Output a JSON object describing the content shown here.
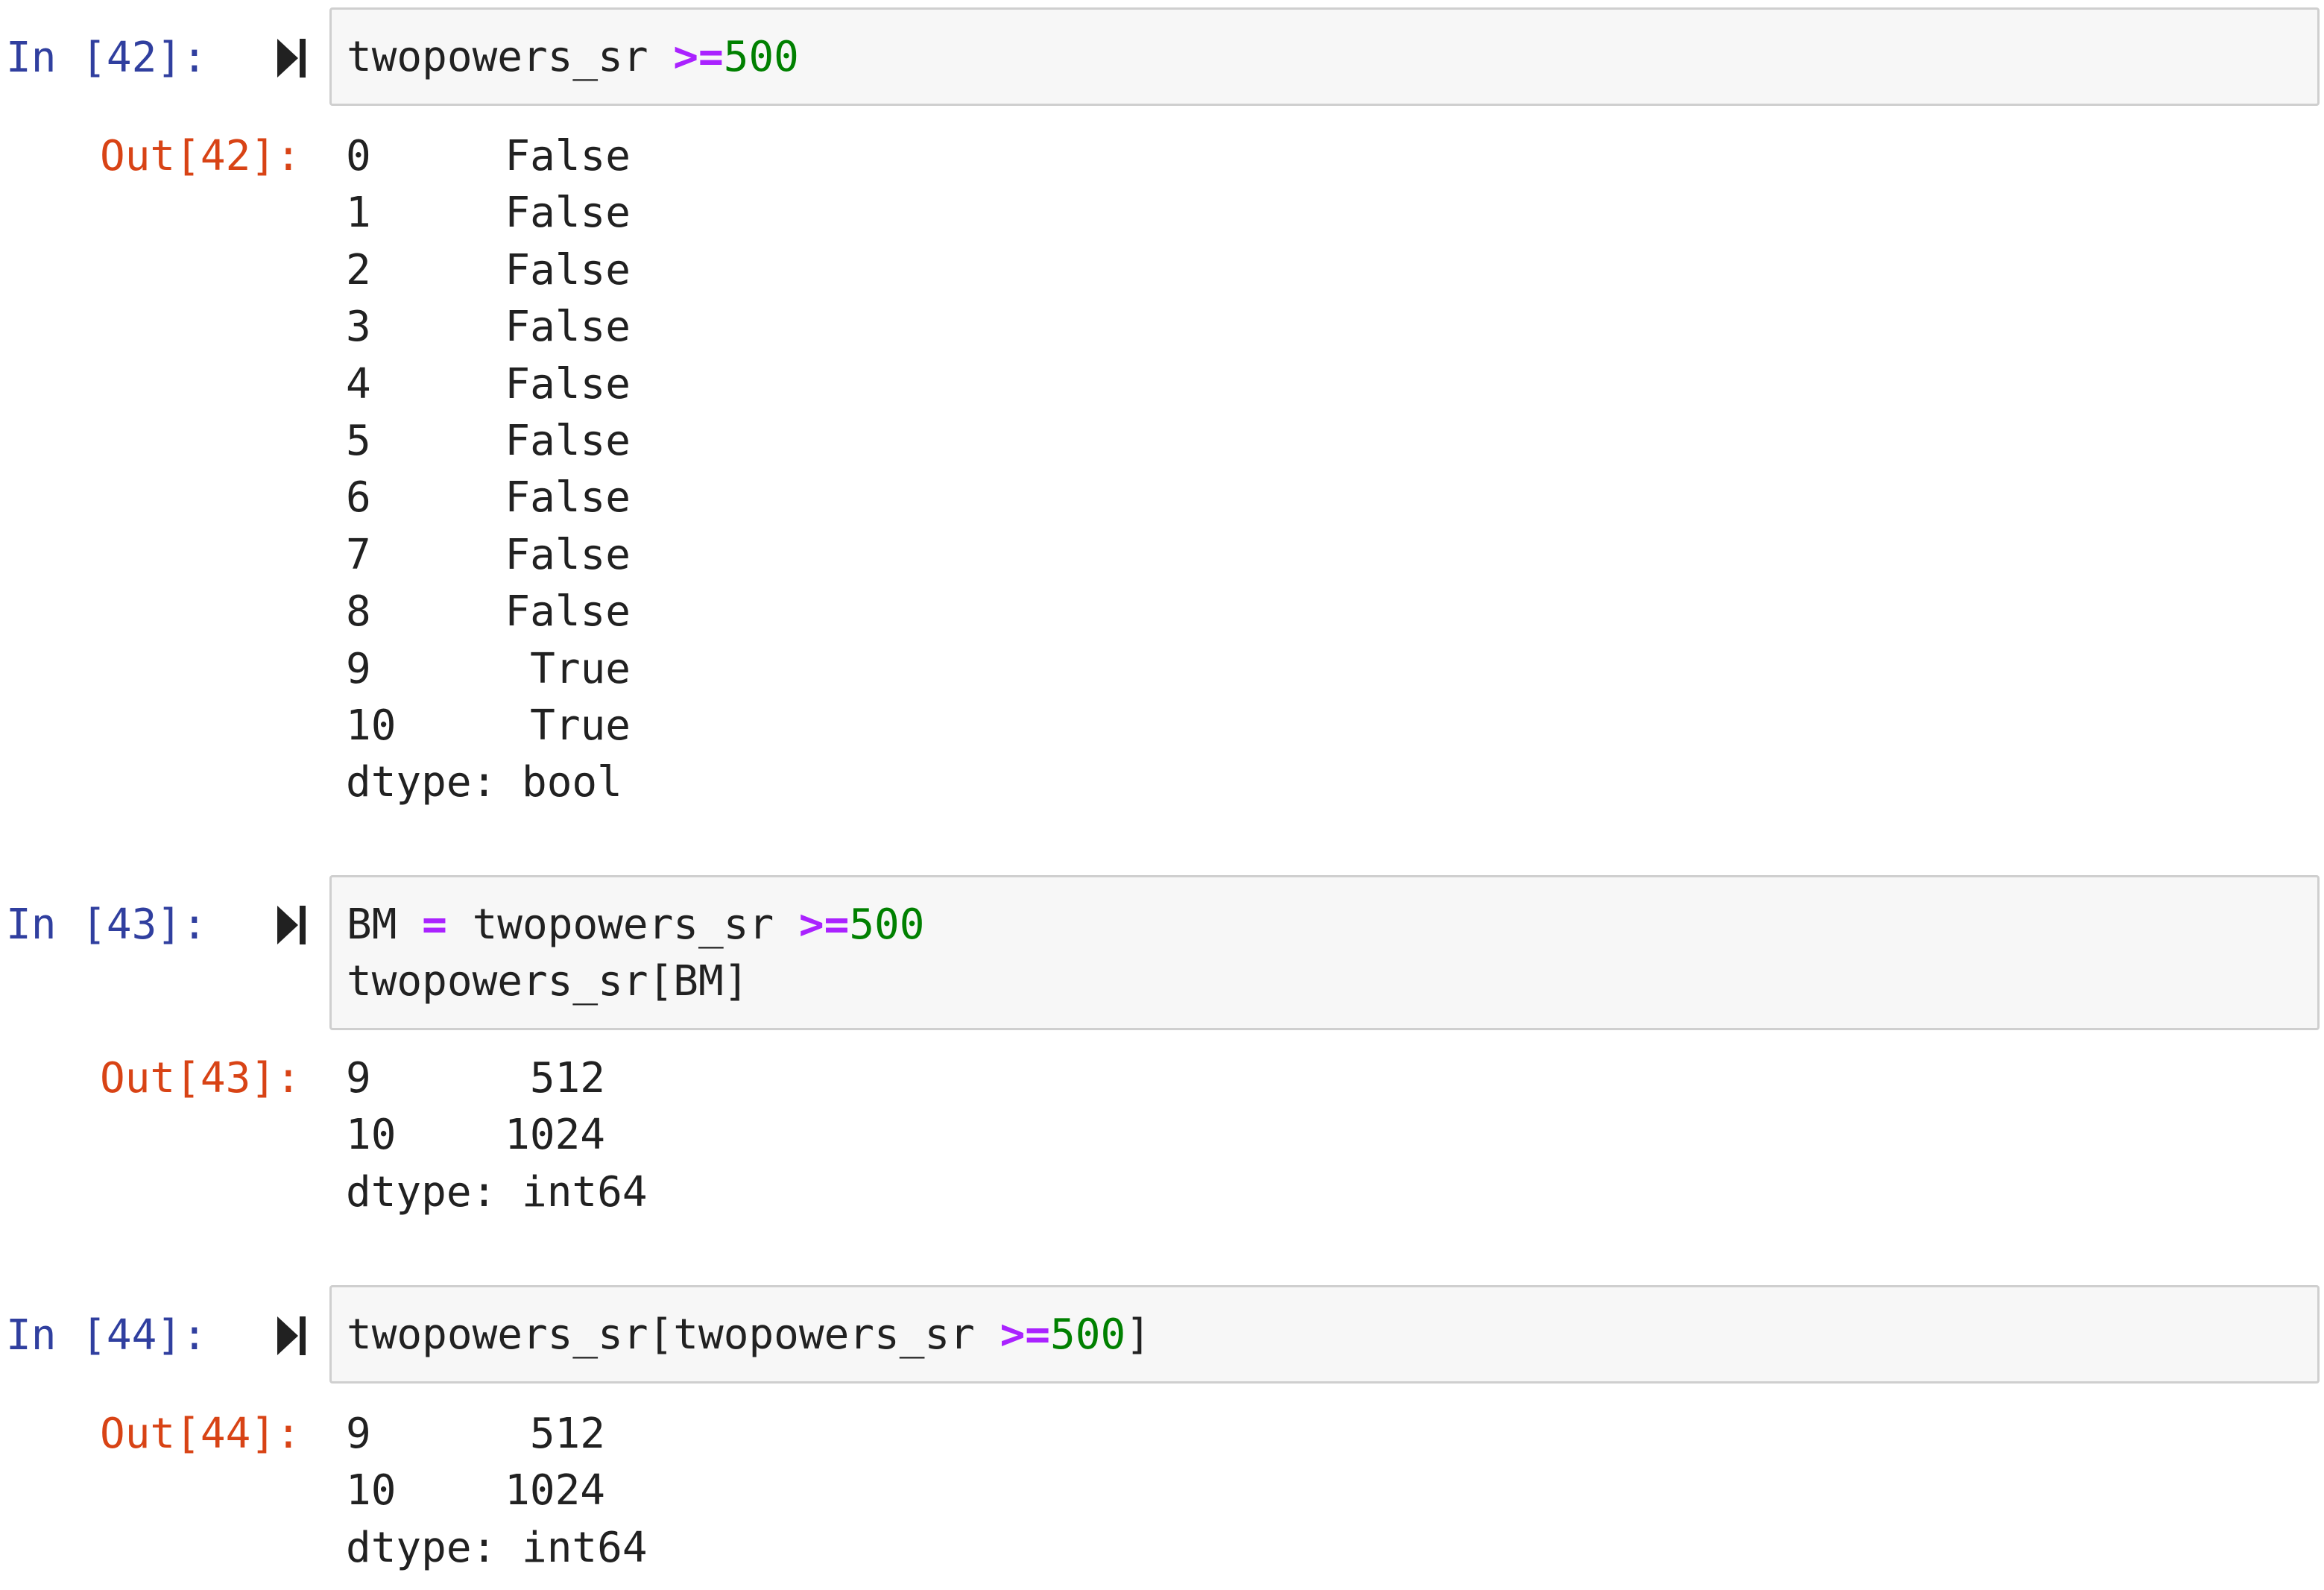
{
  "cells": [
    {
      "in_prompt": "In [42]:",
      "out_prompt": "Out[42]:",
      "input_lines": [
        [
          {
            "t": "twopowers_sr ",
            "c": "plain"
          },
          {
            "t": ">=",
            "c": "op"
          },
          {
            "t": "500",
            "c": "num"
          }
        ]
      ],
      "output_rows": [
        {
          "index": "0",
          "value": "False"
        },
        {
          "index": "1",
          "value": "False"
        },
        {
          "index": "2",
          "value": "False"
        },
        {
          "index": "3",
          "value": "False"
        },
        {
          "index": "4",
          "value": "False"
        },
        {
          "index": "5",
          "value": "False"
        },
        {
          "index": "6",
          "value": "False"
        },
        {
          "index": "7",
          "value": "False"
        },
        {
          "index": "8",
          "value": "False"
        },
        {
          "index": "9",
          "value": "True"
        },
        {
          "index": "10",
          "value": "True"
        }
      ],
      "dtype": "dtype: bool"
    },
    {
      "in_prompt": "In [43]:",
      "out_prompt": "Out[43]:",
      "input_lines": [
        [
          {
            "t": "BM ",
            "c": "plain"
          },
          {
            "t": "=",
            "c": "op"
          },
          {
            "t": " twopowers_sr ",
            "c": "plain"
          },
          {
            "t": ">=",
            "c": "op"
          },
          {
            "t": "500",
            "c": "num"
          }
        ],
        [
          {
            "t": "twopowers_sr[BM]",
            "c": "plain"
          }
        ]
      ],
      "output_rows": [
        {
          "index": "9",
          "value": "512"
        },
        {
          "index": "10",
          "value": "1024"
        }
      ],
      "dtype": "dtype: int64"
    },
    {
      "in_prompt": "In [44]:",
      "out_prompt": "Out[44]:",
      "input_lines": [
        [
          {
            "t": "twopowers_sr[twopowers_sr ",
            "c": "plain"
          },
          {
            "t": ">=",
            "c": "op"
          },
          {
            "t": "500",
            "c": "num"
          },
          {
            "t": "]",
            "c": "plain"
          }
        ]
      ],
      "output_rows": [
        {
          "index": "9",
          "value": "512"
        },
        {
          "index": "10",
          "value": "1024"
        }
      ],
      "dtype": "dtype: int64"
    }
  ],
  "colors": {
    "in_prompt": "#303f9f",
    "out_prompt": "#d84315",
    "operator": "#aa22ff",
    "number": "#008000",
    "input_bg": "#f7f7f7",
    "input_border": "#cfcfcf"
  },
  "icons": {
    "run": "run-cell-icon"
  }
}
